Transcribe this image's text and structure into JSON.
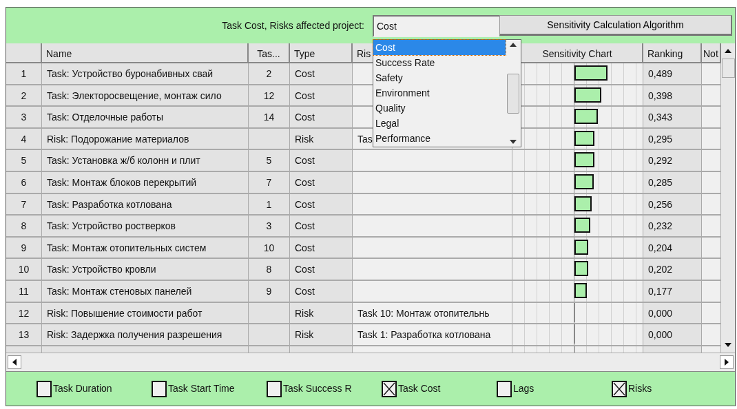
{
  "toolbar": {
    "label": "Task Cost, Risks affected project:",
    "combo": {
      "value": "Cost",
      "expanded": true
    },
    "button": "Sensitivity Calculation Algorithm"
  },
  "dropdown": [
    {
      "label": "Cost",
      "selected": true
    },
    {
      "label": "Success Rate",
      "selected": false
    },
    {
      "label": "Safety",
      "selected": false
    },
    {
      "label": "Environment",
      "selected": false
    },
    {
      "label": "Quality",
      "selected": false
    },
    {
      "label": "Legal",
      "selected": false
    },
    {
      "label": "Performance",
      "selected": false
    }
  ],
  "table": {
    "columns": [
      "Name",
      "Tas...",
      "Type",
      "Ris",
      "Sensitivity Chart",
      "Ranking",
      "Not"
    ],
    "rows": [
      {
        "number": "1",
        "name": "Task: Устройство буронабивных свай",
        "task": "2",
        "type": "Cost",
        "level": 0.489,
        "ranking": "0,489"
      },
      {
        "number": "2",
        "name": "Task: Электоросвещение, монтаж сило",
        "task": "12",
        "type": "Cost",
        "level": 0.398,
        "ranking": "0,398"
      },
      {
        "number": "3",
        "name": "Task: Отделочные работы",
        "task": "14",
        "type": "Cost",
        "level": 0.343,
        "ranking": "0,343"
      },
      {
        "number": "4",
        "name": "Risk: Подорожание материалов",
        "type": "Risk",
        "risk": "Tas",
        "level": 0.295,
        "ranking": "0,295"
      },
      {
        "number": "5",
        "name": "Task: Установка ж/б колонн и плит",
        "task": "5",
        "type": "Cost",
        "level": 0.292,
        "ranking": "0,292"
      },
      {
        "number": "6",
        "name": "Task: Монтаж блоков перекрытий",
        "task": "7",
        "type": "Cost",
        "level": 0.285,
        "ranking": "0,285"
      },
      {
        "number": "7",
        "name": "Task: Разработка котлована",
        "task": "1",
        "type": "Cost",
        "level": 0.256,
        "ranking": "0,256"
      },
      {
        "number": "8",
        "name": "Task: Устройство ростверков",
        "task": "3",
        "type": "Cost",
        "level": 0.232,
        "ranking": "0,232"
      },
      {
        "number": "9",
        "name": "Task: Монтаж отопительных систем",
        "task": "10",
        "type": "Cost",
        "level": 0.204,
        "ranking": "0,204"
      },
      {
        "number": "10",
        "name": "Task: Устройство кровли",
        "task": "8",
        "type": "Cost",
        "level": 0.202,
        "ranking": "0,202"
      },
      {
        "number": "11",
        "name": "Task: Монтаж стеновых панелей",
        "task": "9",
        "type": "Cost",
        "level": 0.177,
        "ranking": "0,177"
      },
      {
        "number": "12",
        "name": "Risk: Повышение стоимости работ",
        "type": "Risk",
        "risk": "Task 10: Монтаж отопительнь",
        "level": 0,
        "ranking": "0,000"
      },
      {
        "number": "13",
        "name": "Risk: Задержка получения разрешения",
        "type": "Risk",
        "risk": "Task 1: Разработка котлована",
        "level": 0,
        "ranking": "0,000"
      }
    ]
  },
  "filters": [
    {
      "label": "Task Duration",
      "checked": false
    },
    {
      "label": "Task Start Time",
      "checked": false
    },
    {
      "label": "Task Success R",
      "checked": false
    },
    {
      "label": "Task Cost",
      "checked": true
    },
    {
      "label": "Lags",
      "checked": false
    },
    {
      "label": "Risks",
      "checked": true
    }
  ]
}
